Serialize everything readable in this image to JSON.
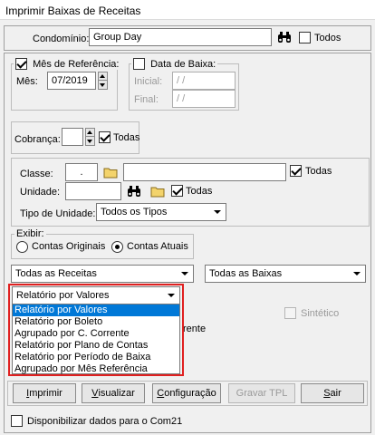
{
  "window": {
    "title": "Imprimir Baixas de Receitas"
  },
  "condominio": {
    "label": "Condomínio:",
    "value": "Group Day",
    "todos_label": "Todos",
    "todos_checked": false
  },
  "mes_ref": {
    "legend": "Mês de Referência:",
    "checked": true,
    "mes_label": "Mês:",
    "mes_value": "07/2019"
  },
  "data_baixa": {
    "legend": "Data de Baixa:",
    "checked": false,
    "inicial_label": "Inicial:",
    "inicial_value": " /  /",
    "final_label": "Final:",
    "final_value": " /  /"
  },
  "cobranca": {
    "label": "Cobrança:",
    "value": "",
    "todas_label": "Todas",
    "todas_checked": true
  },
  "classe": {
    "label": "Classe:",
    "code_value": ".",
    "name_value": "",
    "todas_label": "Todas",
    "todas_checked": true
  },
  "unidade": {
    "label": "Unidade:",
    "value": "",
    "todas_label": "Todas",
    "todas_checked": true
  },
  "tipo_unidade": {
    "label": "Tipo de Unidade:",
    "value": "Todos os Tipos"
  },
  "exibir": {
    "legend": "Exibir:",
    "options": [
      {
        "label": "Contas Originais",
        "checked": false
      },
      {
        "label": "Contas Atuais",
        "checked": true
      }
    ]
  },
  "receitas_combo": {
    "value": "Todas as Receitas"
  },
  "baixas_combo": {
    "value": "Todas as Baixas"
  },
  "relatorio_combo": {
    "value": "Relatório por Valores",
    "options": [
      "Relatório por Valores",
      "Relatório por Boleto",
      "Agrupado por C. Corrente",
      "Relatório por Plano de Contas",
      "Relatório por Período de Baixa",
      "Agrupado por Mês Referência"
    ],
    "selected_index": 0
  },
  "sintetico": {
    "label": "Sintético",
    "checked": false
  },
  "hidden_text": "rente",
  "buttons": {
    "imprimir": {
      "u": "I",
      "rest": "mprimir"
    },
    "visualizar": {
      "u": "V",
      "rest": "isualizar"
    },
    "configuracao": {
      "u": "C",
      "rest": "onfiguração"
    },
    "gravar": {
      "label": "Gravar TPL"
    },
    "sair": {
      "u": "S",
      "rest": "air"
    }
  },
  "com21": {
    "label": "Disponibilizar dados para o Com21",
    "checked": false
  },
  "colors": {
    "highlight": "#e02020",
    "selection": "#0078d7"
  },
  "icons": [
    "binoculars-icon",
    "folder-icon",
    "spin-icon",
    "chevron-down-icon"
  ]
}
